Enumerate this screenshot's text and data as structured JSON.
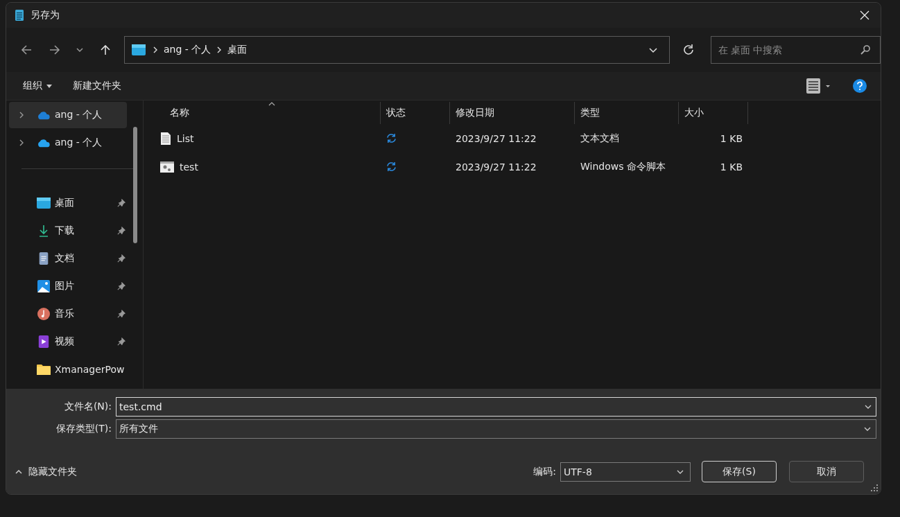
{
  "window": {
    "title": "另存为"
  },
  "address": {
    "crumbs": [
      "ang - 个人",
      "桌面"
    ]
  },
  "search": {
    "placeholder": "在 桌面 中搜索"
  },
  "toolbar": {
    "buttons": [
      {
        "label": "组织",
        "menu": true
      },
      {
        "label": "新建文件夹",
        "menu": false
      }
    ]
  },
  "sidebar": {
    "sections": [
      [
        {
          "label": "ang - 个人",
          "kind": "cloud",
          "selected": true,
          "pinned": false
        },
        {
          "label": "ang - 个人",
          "kind": "cloud2",
          "selected": false,
          "pinned": false
        }
      ],
      [
        {
          "label": "桌面",
          "kind": "desktop",
          "selected": false,
          "pinned": true
        },
        {
          "label": "下载",
          "kind": "download",
          "selected": false,
          "pinned": true
        },
        {
          "label": "文档",
          "kind": "documents",
          "selected": false,
          "pinned": true
        },
        {
          "label": "图片",
          "kind": "pictures",
          "selected": false,
          "pinned": true
        },
        {
          "label": "音乐",
          "kind": "music",
          "selected": false,
          "pinned": true
        },
        {
          "label": "视频",
          "kind": "videos",
          "selected": false,
          "pinned": true
        },
        {
          "label": "XmanagerPow",
          "kind": "folder",
          "selected": false,
          "pinned": false
        }
      ]
    ]
  },
  "table": {
    "columns": [
      {
        "label": "名称",
        "sorted": true
      },
      {
        "label": "状态",
        "sorted": false
      },
      {
        "label": "修改日期",
        "sorted": false
      },
      {
        "label": "类型",
        "sorted": false
      },
      {
        "label": "大小",
        "sorted": false
      }
    ],
    "rows": [
      {
        "name": "List",
        "kind": "text",
        "synced": true,
        "date": "2023/9/27 11:22",
        "type": "文本文档",
        "size": "1 KB"
      },
      {
        "name": "test",
        "kind": "script",
        "synced": true,
        "date": "2023/9/27 11:22",
        "type": "Windows 命令脚本",
        "size": "1 KB"
      }
    ]
  },
  "form": {
    "filename_label": "文件名(N):",
    "filename": "test.cmd",
    "filetype_label": "保存类型(T):",
    "filetype": "所有文件",
    "encoding_label": "编码:",
    "encoding": "UTF-8"
  },
  "footer": {
    "hide_folders": "隐藏文件夹",
    "buttons": [
      {
        "label": "保存(S)",
        "default": true
      },
      {
        "label": "取消",
        "default": false
      }
    ]
  }
}
